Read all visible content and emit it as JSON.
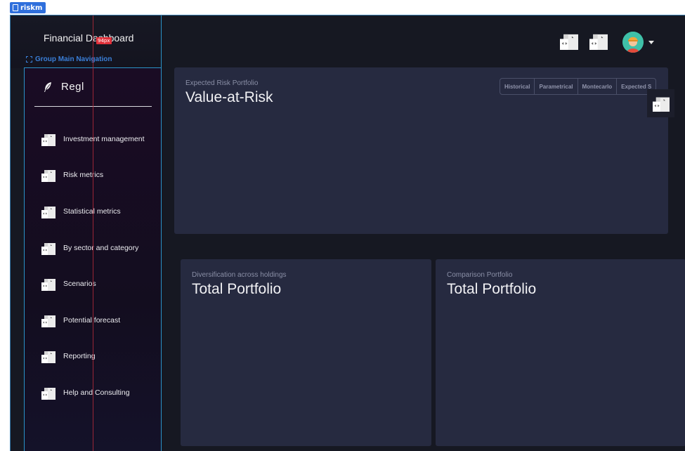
{
  "frame": {
    "tab_label": "riskm"
  },
  "header": {
    "title": "Financial Dashboard",
    "measure_badge": "94px",
    "group_label": "Group Main Navigation"
  },
  "sidebar": {
    "brand": "Regl",
    "items": [
      {
        "label": "Investment management"
      },
      {
        "label": "Risk metrics"
      },
      {
        "label": "Statistical metrics"
      },
      {
        "label": "By sector and category"
      },
      {
        "label": "Scenarios"
      },
      {
        "label": "Potential forecast"
      },
      {
        "label": "Reporting"
      },
      {
        "label": "Help and Consulting"
      }
    ]
  },
  "var_card": {
    "subtitle": "Expected Risk Portfolio",
    "title": "Value-at-Risk",
    "methods": [
      "Historical",
      "Parametrical",
      "Montecarlo",
      "Expected S"
    ]
  },
  "div_card": {
    "subtitle": "Diversification across holdings",
    "title": "Total Portfolio"
  },
  "cmp_card": {
    "subtitle": "Comparison Portfolio",
    "title": "Total Portfolio"
  },
  "colors": {
    "frame_bg": "#161822",
    "card_bg": "#262a40",
    "sidebar_border": "#2a93c8",
    "accent_blue": "#2f6fdc",
    "avatar_bg": "#3fc0a8"
  },
  "icons": [
    "document-icon",
    "feather-logo-icon",
    "image-placeholder-icon",
    "user-avatar-icon",
    "caret-down-icon"
  ]
}
